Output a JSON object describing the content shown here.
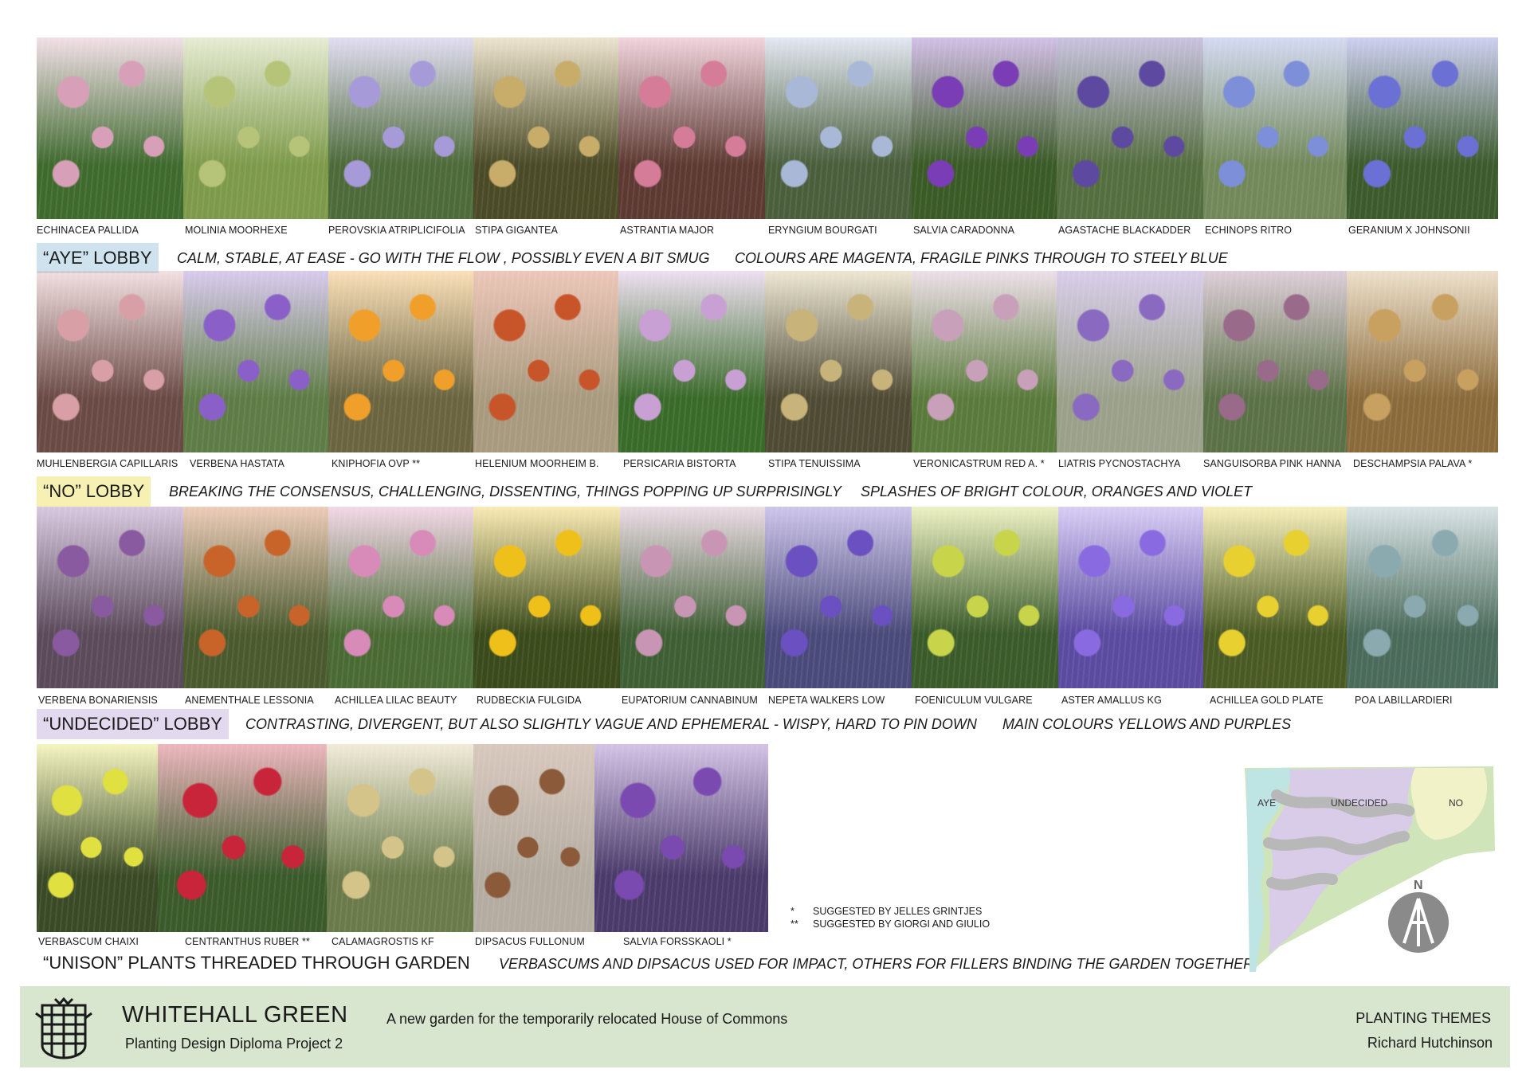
{
  "lobbies": [
    {
      "tag": "“AYE” LOBBY",
      "tag_color": "#cfe3ee",
      "mood": "CALM, STABLE, AT EASE - GO WITH THE FLOW , POSSIBLY EVEN A BIT SMUG",
      "colours": "COLOURS ARE MAGENTA, FRAGILE PINKS THROUGH TO STEELY BLUE",
      "plants": [
        {
          "name": "ECHINACEA PALLIDA",
          "color": "#d8a0b8",
          "bg": "#3f6a2e"
        },
        {
          "name": "MOLINIA MOORHEXE",
          "color": "#b6c47a",
          "bg": "#7d9a4a"
        },
        {
          "name": "PEROVSKIA ATRIPLICIFOLIA",
          "color": "#a79ad8",
          "bg": "#4d6a3a"
        },
        {
          "name": "STIPA GIGANTEA",
          "color": "#c8ad6a",
          "bg": "#4a4a26"
        },
        {
          "name": "ASTRANTIA MAJOR",
          "color": "#d47c98",
          "bg": "#5c3a32"
        },
        {
          "name": "ERYNGIUM BOURGATI",
          "color": "#aab8d8",
          "bg": "#4a5e3c"
        },
        {
          "name": "SALVIA CARADONNA",
          "color": "#7a3db6",
          "bg": "#3a5a26"
        },
        {
          "name": "AGASTACHE BLACKADDER",
          "color": "#5d4aa0",
          "bg": "#556e40"
        },
        {
          "name": "ECHINOPS RITRO",
          "color": "#7d8fd8",
          "bg": "#72885a"
        },
        {
          "name": "GERANIUM X JOHNSONII",
          "color": "#6a70d4",
          "bg": "#3c5a2c"
        }
      ]
    },
    {
      "tag": "“NO” LOBBY",
      "tag_color": "#f6f0b3",
      "mood": "BREAKING THE CONSENSUS, CHALLENGING, DISSENTING, THINGS POPPING UP SURPRISINGLY",
      "colours": "SPLASHES OF BRIGHT COLOUR, ORANGES AND VIOLET",
      "plants": [
        {
          "name": "MUHLENBERGIA CAPILLARIS",
          "color": "#d8a0a6",
          "bg": "#6a4a44"
        },
        {
          "name": "VERBENA HASTATA",
          "color": "#8a60c8",
          "bg": "#5e7c46"
        },
        {
          "name": "KNIPHOFIA OVP **",
          "color": "#f0a02a",
          "bg": "#6a6440"
        },
        {
          "name": "HELENIUM MOORHEIM B.",
          "color": "#c8542a",
          "bg": "#a89a7e"
        },
        {
          "name": "PERSICARIA BISTORTA",
          "color": "#c8a0d4",
          "bg": "#3a6a2a"
        },
        {
          "name": "STIPA TENUISSIMA",
          "color": "#c8b47a",
          "bg": "#4e4a34"
        },
        {
          "name": "VERONICASTRUM RED A. *",
          "color": "#c8a0ba",
          "bg": "#5a7a3c"
        },
        {
          "name": "LIATRIS PYCNOSTACHYA",
          "color": "#8a6ac0",
          "bg": "#9aa08a"
        },
        {
          "name": "SANGUISORBA PINK HANNA",
          "color": "#9a6a8a",
          "bg": "#5a7046"
        },
        {
          "name": "DESCHAMPSIA PALAVA *",
          "color": "#c8a060",
          "bg": "#8a6a3a"
        }
      ]
    },
    {
      "tag": "“UNDECIDED” LOBBY",
      "tag_color": "#e2d9ef",
      "mood": "CONTRASTING, DIVERGENT, BUT ALSO SLIGHTLY VAGUE AND EPHEMERAL -  WISPY,  HARD TO PIN DOWN",
      "colours": "MAIN COLOURS YELLOWS AND PURPLES",
      "plants": [
        {
          "name": "VERBENA BONARIENSIS",
          "color": "#8a5aa0",
          "bg": "#5a4a5a"
        },
        {
          "name": "ANEMENTHALE LESSONIA",
          "color": "#c8642a",
          "bg": "#4a5a2e"
        },
        {
          "name": "ACHILLEA LILAC BEAUTY",
          "color": "#d88ab8",
          "bg": "#4a6a34"
        },
        {
          "name": "RUDBECKIA FULGIDA",
          "color": "#f0c01a",
          "bg": "#3a4a1a"
        },
        {
          "name": "EUPATORIUM CANNABINUM",
          "color": "#c896b4",
          "bg": "#3e5e34"
        },
        {
          "name": "NEPETA WALKERS LOW",
          "color": "#6a50c0",
          "bg": "#4a4a7a"
        },
        {
          "name": "FOENICULUM VULGARE",
          "color": "#c8d44a",
          "bg": "#3a5a2a"
        },
        {
          "name": "ASTER AMALLUS KG",
          "color": "#8a6ae0",
          "bg": "#5a4aa0"
        },
        {
          "name": "ACHILLEA GOLD PLATE",
          "color": "#e8d030",
          "bg": "#4a5a24"
        },
        {
          "name": "POA LABILLARDIERI",
          "color": "#8aaab0",
          "bg": "#4a6a5a"
        }
      ]
    }
  ],
  "unison": {
    "title": "“UNISON” PLANTS THREADED THROUGH GARDEN",
    "description": "VERBASCUMS AND DIPSACUS USED FOR IMPACT, OTHERS FOR FILLERS BINDING THE GARDEN TOGETHER",
    "plants": [
      {
        "name": "VERBASCUM CHAIXI",
        "color": "#e0e040",
        "bg": "#3a4a26"
      },
      {
        "name": "CENTRANTHUS RUBER **",
        "color": "#c8243a",
        "bg": "#3a5a2a"
      },
      {
        "name": "CALAMAGROSTIS KF",
        "color": "#d4c48a",
        "bg": "#6a7a4a"
      },
      {
        "name": "DIPSACUS FULLONUM",
        "color": "#8a5a3a",
        "bg": "#b4aca0"
      },
      {
        "name": "SALVIA FORSSKAOLI *",
        "color": "#7a4ab0",
        "bg": "#4a3a6a"
      }
    ]
  },
  "notes": [
    {
      "mark": "*",
      "text": "SUGGESTED BY JELLES GRINTJES"
    },
    {
      "mark": "**",
      "text": "SUGGESTED BY GIORGI AND GIULIO"
    }
  ],
  "map": {
    "labels": {
      "aye": "AYE",
      "undecided": "UNDECIDED",
      "no": "NO"
    },
    "north": "N",
    "colors": {
      "aye": "#bfe4e4",
      "undecided": "#d8cce8",
      "no": "#f2f2c8",
      "path": "#b8b8b8",
      "edge": "#9ed0c0",
      "green": "#cfe4b8"
    }
  },
  "footer": {
    "title": "WHITEHALL GREEN",
    "subtitle": "Planting Design Diploma Project 2",
    "tagline": "A new garden for the temporarily relocated House of Commons",
    "theme": "PLANTING THEMES",
    "author": "Richard Hutchinson",
    "background": "#d8e5cf"
  }
}
